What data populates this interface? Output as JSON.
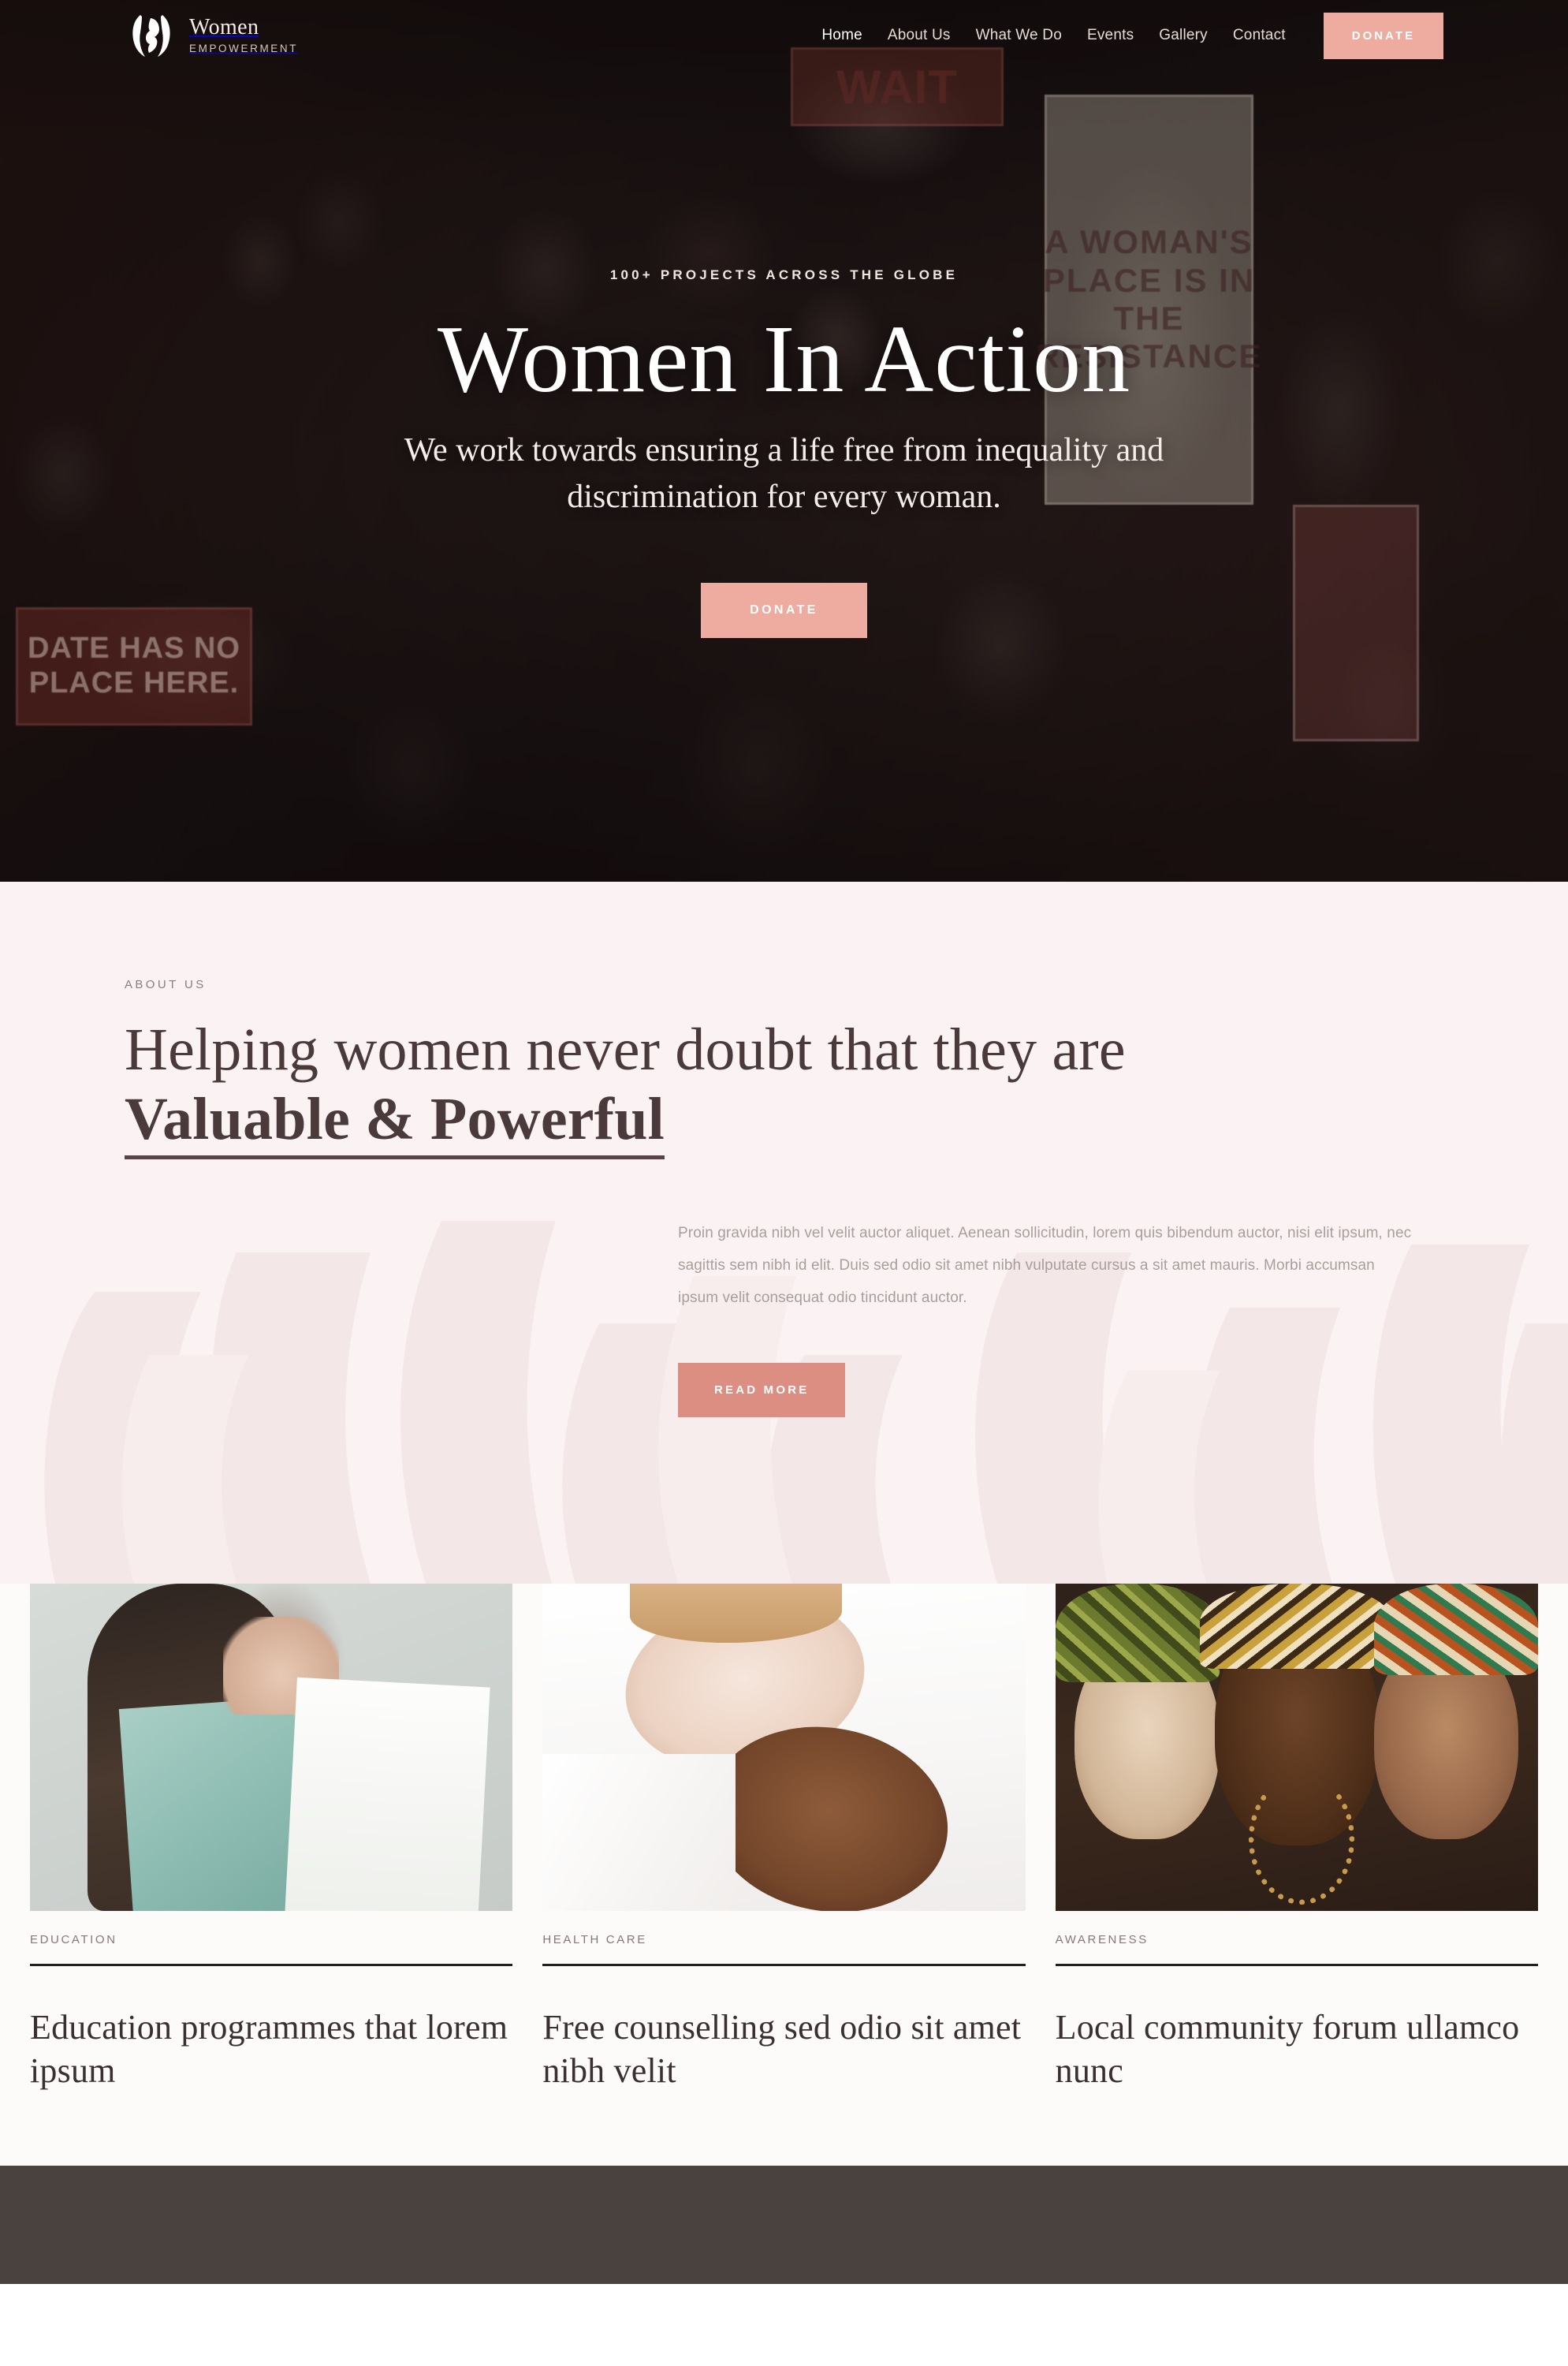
{
  "brand": {
    "title": "Women",
    "subtitle": "EMPOWERMENT",
    "logo_icon": "woman-silhouette-crescent-icon"
  },
  "nav": {
    "items": [
      {
        "label": "Home",
        "active": true
      },
      {
        "label": "About Us",
        "active": false
      },
      {
        "label": "What We Do",
        "active": false
      },
      {
        "label": "Events",
        "active": false
      },
      {
        "label": "Gallery",
        "active": false
      },
      {
        "label": "Contact",
        "active": false
      }
    ],
    "donate_label": "DONATE"
  },
  "hero": {
    "eyebrow": "100+ PROJECTS ACROSS THE GLOBE",
    "title": "Women In Action",
    "subtitle": "We work towards ensuring a life free from inequality and discrimination for every woman.",
    "cta_label": "DONATE",
    "signs": {
      "wait": "WAIT",
      "resistance": "A WOMAN'S PLACE IS IN THE RESISTANCE",
      "date": "DATE HAS NO PLACE HERE.",
      "right": ""
    }
  },
  "about": {
    "eyebrow": "ABOUT US",
    "heading_lead": "Helping women never doubt that they are ",
    "heading_highlight": "Valuable & Powerful",
    "paragraph": "Proin gravida nibh vel velit auctor aliquet. Aenean sollicitudin, lorem quis bibendum auctor, nisi elit ipsum, nec sagittis sem nibh id elit. Duis sed odio sit amet nibh vulputate cursus a sit amet mauris. Morbi accumsan ipsum velit consequat odio tincidunt auctor.",
    "cta_label": "READ MORE"
  },
  "cards": [
    {
      "category": "EDUCATION",
      "title": "Education programmes that lorem ipsum",
      "image_alt": "woman-holding-mint-book-photo"
    },
    {
      "category": "HEALTH CARE",
      "title": "Free counselling sed odio sit amet nibh velit",
      "image_alt": "two-women-lying-down-photo"
    },
    {
      "category": "AWARENESS",
      "title": "Local community forum ullamco nunc",
      "image_alt": "three-women-face-paint-photo"
    }
  ],
  "colors": {
    "accent_pink": "#eeab9f",
    "accent_coral": "#dd8e82",
    "about_bg": "#fbf3f3",
    "heading_dark": "#4a3a3c",
    "footer_bg": "#4a423f"
  }
}
